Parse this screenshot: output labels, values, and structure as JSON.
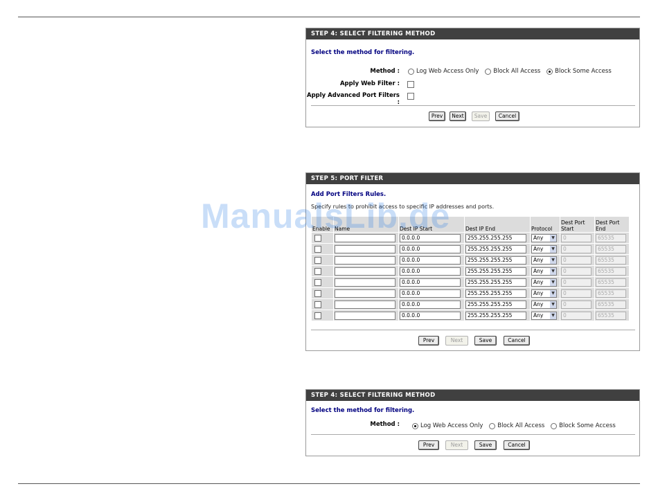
{
  "panel1": {
    "title": "STEP 4: SELECT FILTERING METHOD",
    "subtitle": "Select the method for filtering.",
    "method_label": "Method :",
    "methods": [
      "Log Web Access Only",
      "Block All Access",
      "Block Some Access"
    ],
    "selected_method": "Block Some Access",
    "apply_web_filter_label": "Apply Web Filter :",
    "apply_adv_port_label": "Apply Advanced Port Filters :",
    "buttons": {
      "prev": "Prev",
      "next": "Next",
      "save": "Save",
      "cancel": "Cancel"
    }
  },
  "panel2": {
    "title": "STEP 5: PORT FILTER",
    "subtitle": "Add Port Filters Rules.",
    "description": "Specify rules to prohibit access to specific IP addresses and ports.",
    "columns": [
      "Enable",
      "Name",
      "Dest IP Start",
      "Dest IP End",
      "Protocol",
      "Dest Port Start",
      "Dest Port End"
    ],
    "rows": [
      {
        "name": "",
        "ip_start": "0.0.0.0",
        "ip_end": "255.255.255.255",
        "protocol": "Any",
        "port_start": "0",
        "port_end": "65535"
      },
      {
        "name": "",
        "ip_start": "0.0.0.0",
        "ip_end": "255.255.255.255",
        "protocol": "Any",
        "port_start": "0",
        "port_end": "65535"
      },
      {
        "name": "",
        "ip_start": "0.0.0.0",
        "ip_end": "255.255.255.255",
        "protocol": "Any",
        "port_start": "0",
        "port_end": "65535"
      },
      {
        "name": "",
        "ip_start": "0.0.0.0",
        "ip_end": "255.255.255.255",
        "protocol": "Any",
        "port_start": "0",
        "port_end": "65535"
      },
      {
        "name": "",
        "ip_start": "0.0.0.0",
        "ip_end": "255.255.255.255",
        "protocol": "Any",
        "port_start": "0",
        "port_end": "65535"
      },
      {
        "name": "",
        "ip_start": "0.0.0.0",
        "ip_end": "255.255.255.255",
        "protocol": "Any",
        "port_start": "0",
        "port_end": "65535"
      },
      {
        "name": "",
        "ip_start": "0.0.0.0",
        "ip_end": "255.255.255.255",
        "protocol": "Any",
        "port_start": "0",
        "port_end": "65535"
      },
      {
        "name": "",
        "ip_start": "0.0.0.0",
        "ip_end": "255.255.255.255",
        "protocol": "Any",
        "port_start": "0",
        "port_end": "65535"
      }
    ],
    "buttons": {
      "prev": "Prev",
      "next": "Next",
      "save": "Save",
      "cancel": "Cancel"
    }
  },
  "panel3": {
    "title": "STEP 4: SELECT FILTERING METHOD",
    "subtitle": "Select the method for filtering.",
    "method_label": "Method :",
    "methods": [
      "Log Web Access Only",
      "Block All Access",
      "Block Some Access"
    ],
    "selected_method": "Log Web Access Only",
    "buttons": {
      "prev": "Prev",
      "next": "Next",
      "save": "Save",
      "cancel": "Cancel"
    }
  },
  "watermark": "ManualsLib.de",
  "icons": {
    "dropdown": "chevron-down-icon",
    "radio": "radio-icon",
    "checkbox": "checkbox-icon"
  },
  "colors": {
    "header_bg": "#404040",
    "subtitle": "#000080",
    "watermark": "#2e7ee6"
  }
}
